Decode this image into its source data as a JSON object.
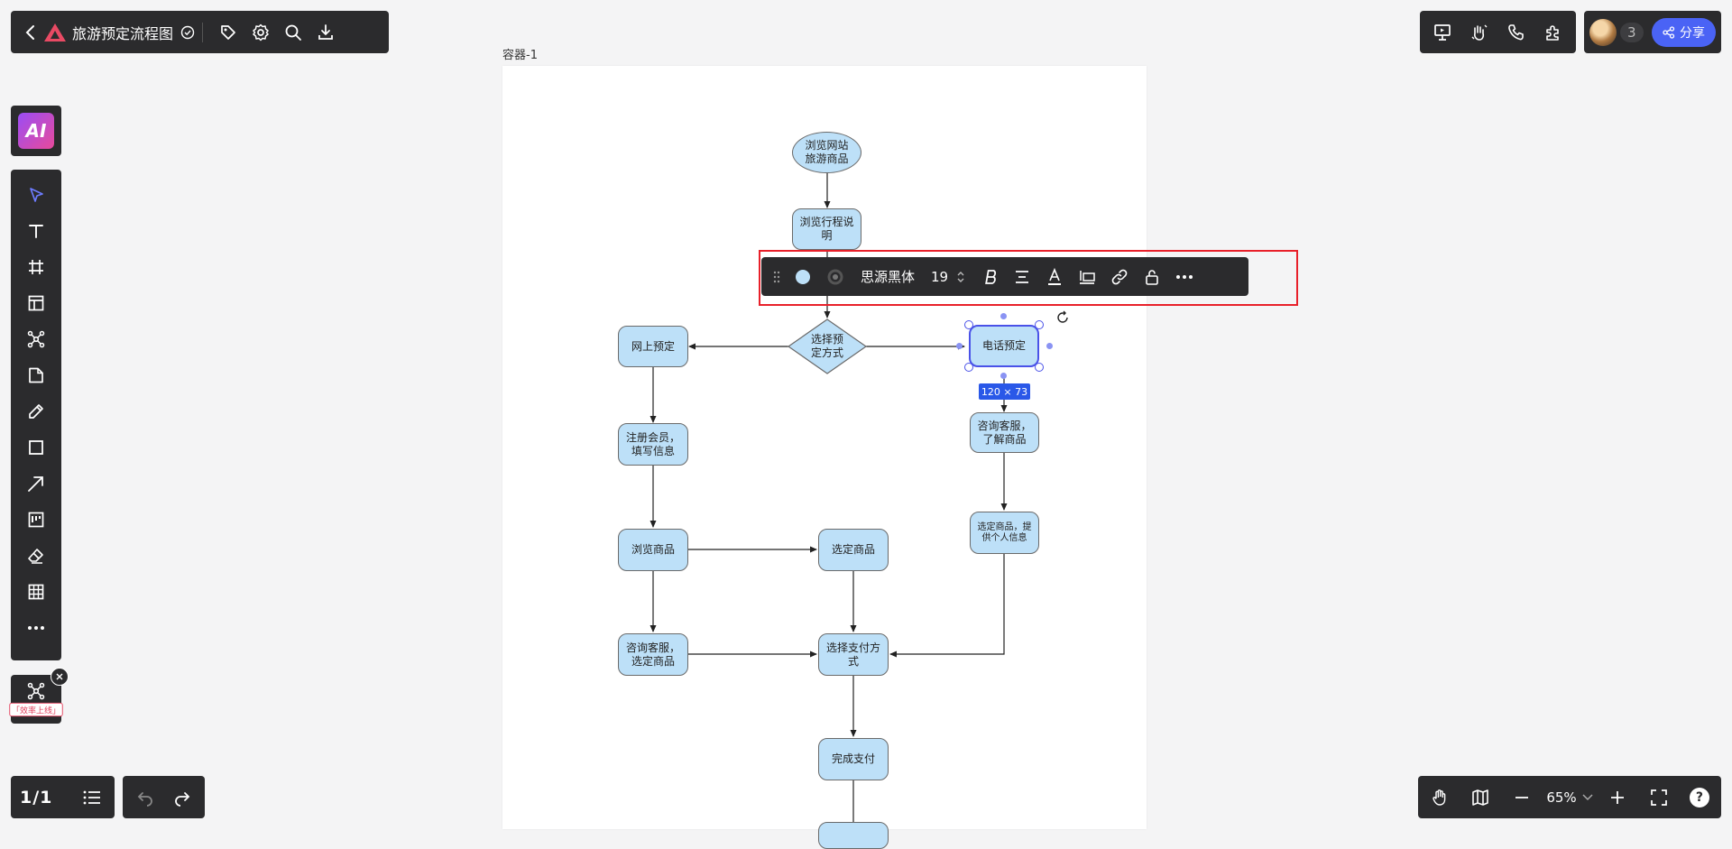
{
  "header": {
    "title": "旅游预定流程图",
    "icons": [
      "back-icon",
      "logo-icon",
      "saved-check-icon",
      "tag-icon",
      "settings-icon",
      "search-icon",
      "download-icon"
    ]
  },
  "top_right": {
    "tools": [
      "present-icon",
      "hand-wave-icon",
      "phone-icon",
      "plugin-icon"
    ],
    "collaborator_count": "3",
    "share_label": "分享"
  },
  "ai": {
    "label": "AI"
  },
  "left_tools": [
    "select-icon",
    "text-icon",
    "frame-icon",
    "layout-icon",
    "mindmap-icon",
    "sticky-note-icon",
    "pen-icon",
    "rectangle-icon",
    "arrow-icon",
    "kanban-icon",
    "eraser-icon",
    "table-icon",
    "more-icon"
  ],
  "plugin": {
    "label": "「效率上线」"
  },
  "pagination": {
    "current": "1/1"
  },
  "zoom": {
    "value": "65%"
  },
  "canvas": {
    "container_label": "容器-1"
  },
  "text_toolbar": {
    "fill_color": "#bde0f8",
    "border_color": "#555555",
    "font_name": "思源黑体",
    "font_size": "19"
  },
  "selection": {
    "size_label": "120 × 73"
  },
  "flowchart": {
    "start": "浏览网站\n旅游商品",
    "itinerary": "浏览行程说\n明",
    "choose_method": "选择预\n定方式",
    "online": "网上预定",
    "phone": "电话预定",
    "register": "注册会员，\n填写信息",
    "consult_phone": "咨询客服，\n了解商品",
    "select_provide": "选定商品，提\n供个人信息",
    "browse_products": "浏览商品",
    "select_product": "选定商品",
    "consult_select": "咨询客服，\n选定商品",
    "choose_payment": "选择支付方\n式",
    "complete_payment": "完成支付"
  },
  "colors": {
    "node_fill": "#bde0f8",
    "accent": "#4a52e8",
    "share_button": "#4a63f5",
    "highlight": "#e8202a",
    "toolbar_bg": "#2b2b2d"
  }
}
